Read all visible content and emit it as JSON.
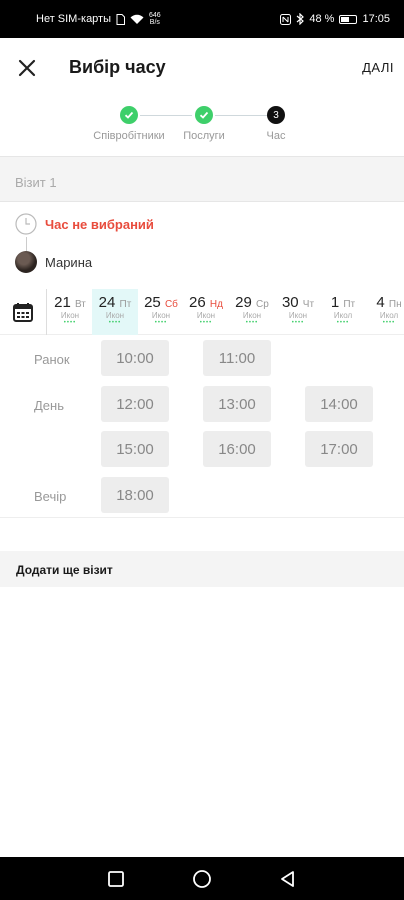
{
  "status_bar": {
    "carrier": "Нет SIM-карты",
    "speed_value": "646",
    "speed_unit": "B/s",
    "battery": "48 %",
    "battery_level": 0.48,
    "time": "17:05"
  },
  "app_bar": {
    "title": "Вибір часу",
    "next_label": "ДАЛІ"
  },
  "steps": [
    {
      "label": "Співробітники",
      "state": "done"
    },
    {
      "label": "Послуги",
      "state": "done"
    },
    {
      "label": "Час",
      "state": "current",
      "number": "3"
    }
  ],
  "visit": {
    "header": "Візит 1",
    "time_status": "Час не вибраний",
    "master_name": "Марина"
  },
  "calendar": {
    "days": [
      {
        "num": "21",
        "dow": "Вт",
        "sub": "Икон",
        "weekend": false,
        "selected": false
      },
      {
        "num": "24",
        "dow": "Пт",
        "sub": "Икон",
        "weekend": false,
        "selected": true
      },
      {
        "num": "25",
        "dow": "Сб",
        "sub": "Икон",
        "weekend": true,
        "selected": false
      },
      {
        "num": "26",
        "dow": "Нд",
        "sub": "Икон",
        "weekend": true,
        "selected": false
      },
      {
        "num": "29",
        "dow": "Ср",
        "sub": "Икон",
        "weekend": false,
        "selected": false
      },
      {
        "num": "30",
        "dow": "Чт",
        "sub": "Икон",
        "weekend": false,
        "selected": false
      },
      {
        "num": "1",
        "dow": "Пт",
        "sub": "Икол",
        "weekend": false,
        "selected": false
      },
      {
        "num": "4",
        "dow": "Пн",
        "sub": "Икол",
        "weekend": false,
        "selected": false
      }
    ],
    "dots": "••••"
  },
  "time_slots": {
    "periods": {
      "morning": "Ранок",
      "day": "День",
      "evening": "Вечір"
    },
    "morning": [
      "10:00",
      "11:00"
    ],
    "day": [
      "12:00",
      "13:00",
      "14:00",
      "15:00",
      "16:00",
      "17:00"
    ],
    "evening": [
      "18:00"
    ]
  },
  "add_visit_label": "Додати ще візит",
  "colors": {
    "done": "#3ecf6a",
    "current": "#111111",
    "alert": "#e84c3d",
    "selected_day": "#e3f8f8"
  }
}
